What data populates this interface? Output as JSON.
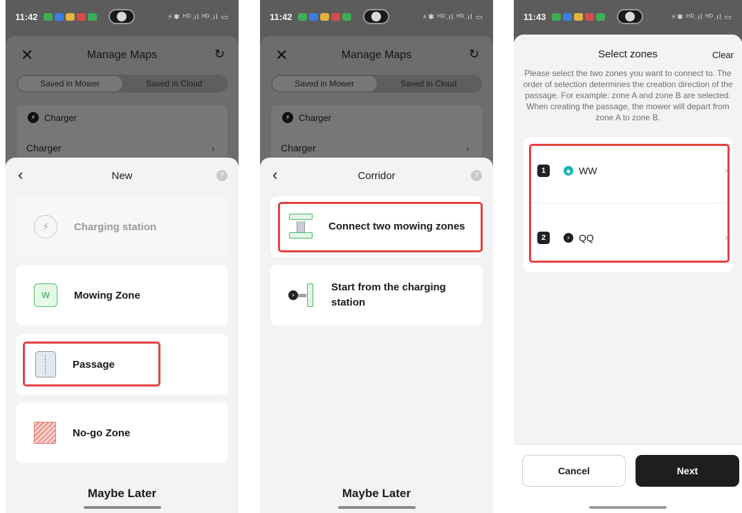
{
  "status_bar": {
    "time_1": "11:42",
    "time_2": "11:42",
    "time_3": "11:43",
    "signal": "⚡✱ ᴴᴰ.ıl ᴴᴰ.ıl ▭"
  },
  "manage_maps": {
    "title": "Manage Maps",
    "close_icon": "close-icon",
    "refresh_icon": "refresh-icon",
    "tabs": [
      "Saved in Mower",
      "Saved in Cloud"
    ],
    "charger_header": "Charger",
    "charger_item": "Charger",
    "charger_chevron": "›"
  },
  "panel1": {
    "title": "New",
    "help": "?",
    "options": [
      {
        "label": "Charging station",
        "icon": "charging-station-icon",
        "disabled": true
      },
      {
        "label": "Mowing Zone",
        "icon": "mowing-zone-icon"
      },
      {
        "label": "Passage",
        "icon": "passage-icon",
        "highlighted": true
      },
      {
        "label": "No-go Zone",
        "icon": "no-go-zone-icon"
      }
    ],
    "footer": "Maybe Later"
  },
  "panel2": {
    "title": "Corridor",
    "help": "?",
    "options": [
      {
        "label": "Connect two mowing zones",
        "icon": "connect-zones-icon",
        "highlighted": true
      },
      {
        "label_line1": "Start from the charging",
        "label_line2": "station",
        "icon": "start-charging-icon"
      }
    ],
    "footer": "Maybe Later"
  },
  "panel3": {
    "title": "Select zones",
    "clear": "Clear",
    "description": "Please select the two zones you want to connect to. The order of selection determines the creation direction of the passage. For example: zone A and zone B are selected. When creating the passage, the mower will depart from zone A to zone B.",
    "zones": [
      {
        "order": "1",
        "name": "WW",
        "icon_color": "#17b6bd"
      },
      {
        "order": "2",
        "name": "QQ",
        "icon_color": "#1f1f1f"
      }
    ],
    "cancel": "Cancel",
    "next": "Next"
  },
  "colors": {
    "highlight": "#e64040",
    "accent_green": "#46b865",
    "primary_dark": "#1e1e1e"
  }
}
